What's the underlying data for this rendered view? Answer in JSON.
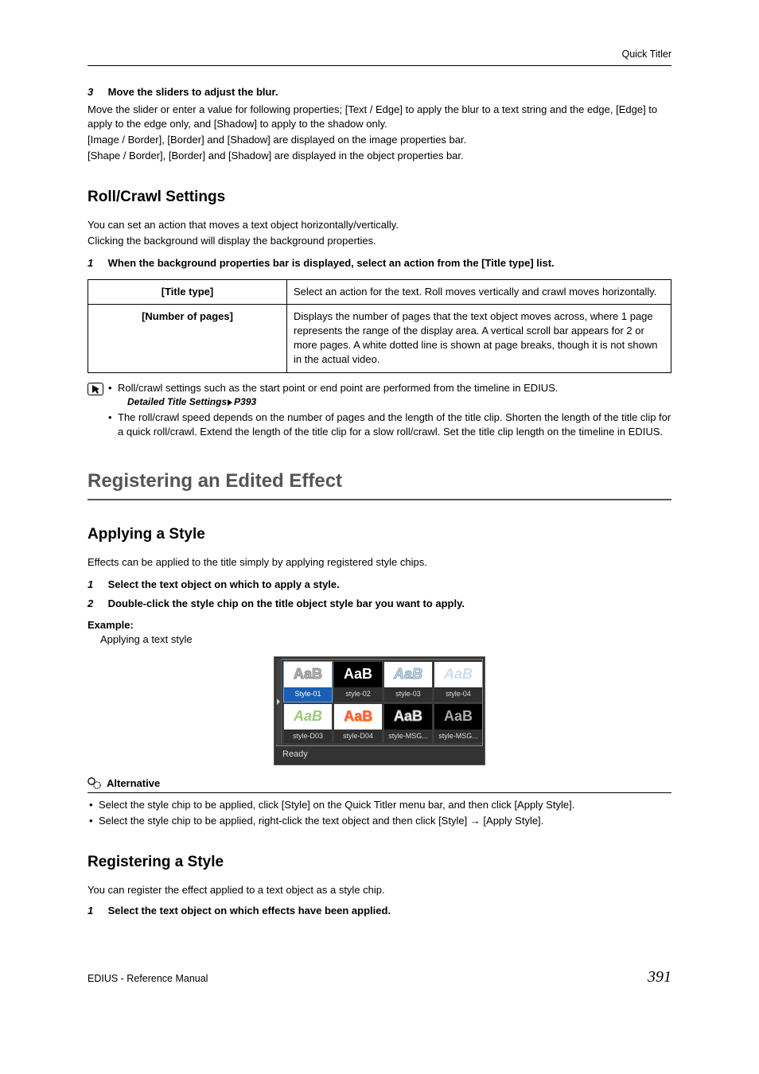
{
  "header": {
    "section": "Quick Titler"
  },
  "step3": {
    "num": "3",
    "title": "Move the sliders to adjust the blur.",
    "p1": "Move the slider or enter a value for following properties; [Text / Edge] to apply the blur to a text string and the edge, [Edge] to apply to the edge only, and [Shadow] to apply to the shadow only.",
    "p2": "[Image / Border], [Border] and [Shadow] are displayed on the image properties bar.",
    "p3": "[Shape / Border], [Border] and [Shadow] are displayed in the object properties bar."
  },
  "roll": {
    "heading": "Roll/Crawl Settings",
    "p1": "You can set an action that moves a text object horizontally/vertically.",
    "p2": "Clicking the background will display the background properties.",
    "step1": {
      "num": "1",
      "title": "When the background properties bar is displayed, select an action from the [Title type] list."
    },
    "table": {
      "r1l": "[Title type]",
      "r1v": "Select an action for the text. Roll moves vertically and crawl moves horizontally.",
      "r2l": "[Number of pages]",
      "r2v": "Displays the number of pages that the text object moves across, where 1 page represents the range of the display area. A vertical scroll bar appears for 2 or more pages. A white dotted line is shown at page breaks, though it is not shown in the actual video."
    },
    "notes": {
      "n1": "Roll/crawl settings such as the start point or end point are performed from the timeline in EDIUS.",
      "xref_label": "Detailed Title Settings",
      "xref_page": "P393",
      "n2": "The roll/crawl speed depends on the number of pages and the length of the title clip. Shorten the length of the title clip for a quick roll/crawl. Extend the length of the title clip for a slow roll/crawl. Set the title clip length on the timeline in EDIUS."
    }
  },
  "register": {
    "heading": "Registering an Edited Effect"
  },
  "apply": {
    "heading": "Applying a Style",
    "intro": "Effects can be applied to the title simply by applying registered style chips.",
    "s1": {
      "num": "1",
      "title": "Select the text object on which to apply a style."
    },
    "s2": {
      "num": "2",
      "title": "Double-click the style chip on the title object style bar you want to apply."
    },
    "example_label": "Example:",
    "example_text": "Applying a text style",
    "chips": [
      {
        "name": "Style-01",
        "sample": "AaB"
      },
      {
        "name": "style-02",
        "sample": "AaB"
      },
      {
        "name": "style-03",
        "sample": "AaB"
      },
      {
        "name": "style-04",
        "sample": "AaB"
      },
      {
        "name": "style-D03",
        "sample": "AaB"
      },
      {
        "name": "style-D04",
        "sample": "AaB"
      },
      {
        "name": "style-MSG...",
        "sample": "AaB"
      },
      {
        "name": "style-MSG...",
        "sample": "AaB"
      }
    ],
    "status": "Ready",
    "alt_heading": "Alternative",
    "alt1": "Select the style chip to be applied, click [Style] on the Quick Titler menu bar, and then click [Apply Style].",
    "alt2": "Select the style chip to be applied, right-click the text object and then click [Style] → [Apply Style]."
  },
  "regstyle": {
    "heading": "Registering a Style",
    "intro": "You can register the effect applied to a text object as a style chip.",
    "s1": {
      "num": "1",
      "title": "Select the text object on which effects have been applied."
    }
  },
  "footer": {
    "left": "EDIUS - Reference Manual",
    "right": "391"
  }
}
